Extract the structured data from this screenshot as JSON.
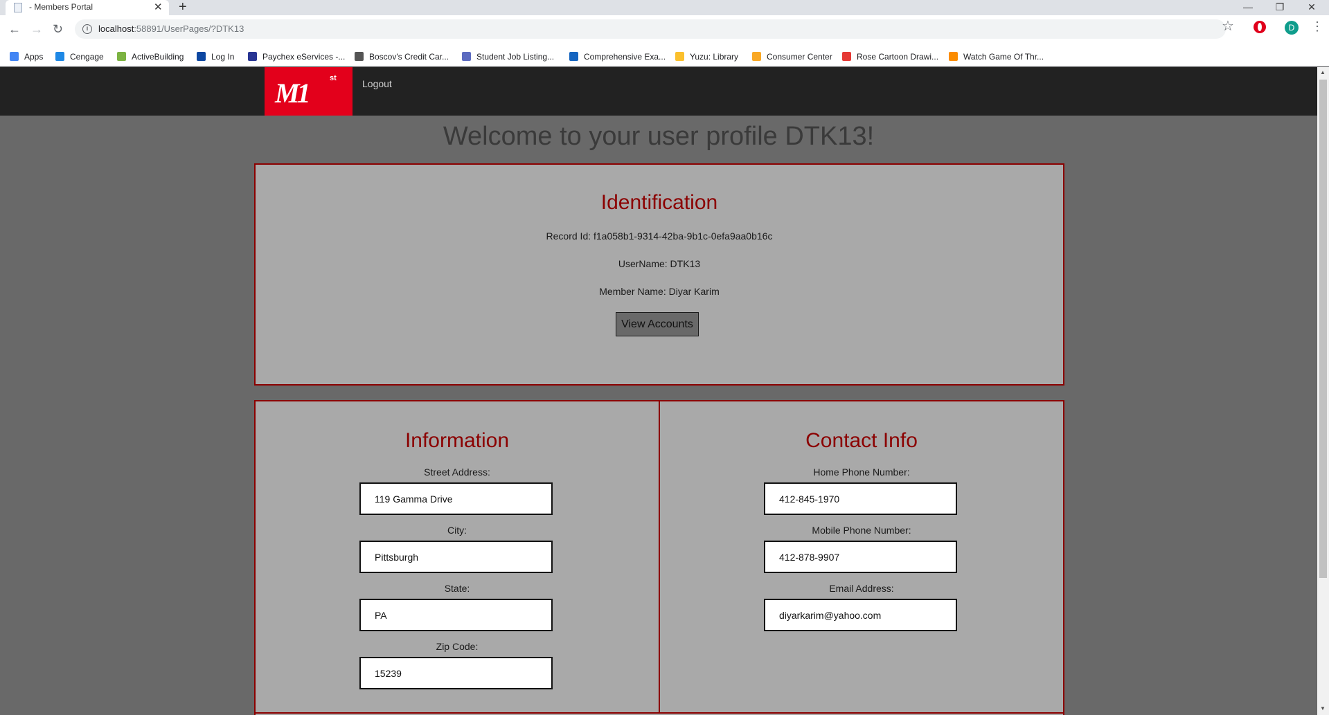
{
  "browser": {
    "tab_title": "- Members Portal",
    "url_host": "localhost",
    "url_path": ":58891/UserPages/?DTK13",
    "profile_initial": "D",
    "bookmarks": [
      {
        "label": "Apps",
        "color": "#4285f4"
      },
      {
        "label": "Cengage",
        "color": "#1e88e5"
      },
      {
        "label": "ActiveBuilding",
        "color": "#7cb342"
      },
      {
        "label": "Log In",
        "color": "#0d47a1"
      },
      {
        "label": "Paychex eServices -...",
        "color": "#283593"
      },
      {
        "label": "Boscov's Credit Car...",
        "color": "#555555"
      },
      {
        "label": "Student Job Listing...",
        "color": "#5c6bc0"
      },
      {
        "label": "Comprehensive Exa...",
        "color": "#1565c0"
      },
      {
        "label": "Yuzu: Library",
        "color": "#fbc02d"
      },
      {
        "label": "Consumer Center",
        "color": "#f9a825"
      },
      {
        "label": "Rose Cartoon Drawi...",
        "color": "#e53935"
      },
      {
        "label": "Watch Game Of Thr...",
        "color": "#fb8c00"
      }
    ]
  },
  "navbar": {
    "logo_text": "M1",
    "logo_sup": "st",
    "logout": "Logout"
  },
  "welcome": "Welcome to your user profile DTK13!",
  "identification": {
    "title": "Identification",
    "record_id": "Record Id: f1a058b1-9314-42ba-9b1c-0efa9aa0b16c",
    "username": "UserName: DTK13",
    "member_name": "Member Name: Diyar Karim",
    "view_accounts": "View Accounts"
  },
  "information": {
    "title": "Information",
    "street_label": "Street Address:",
    "street": "119 Gamma Drive",
    "city_label": "City:",
    "city": "Pittsburgh",
    "state_label": "State:",
    "state": "PA",
    "zip_label": "Zip Code:",
    "zip": "15239"
  },
  "contact": {
    "title": "Contact Info",
    "home_label": "Home Phone Number:",
    "home": "412-845-1970",
    "mobile_label": "Mobile Phone Number:",
    "mobile": "412-878-9907",
    "email_label": "Email Address:",
    "email": "diyarkarim@yahoo.com"
  },
  "colors": {
    "accent": "#8b0000",
    "brand_red": "#e3001b",
    "panel_bg": "#a9a9a9",
    "page_bg": "#696969",
    "navbar_bg": "#222222"
  }
}
